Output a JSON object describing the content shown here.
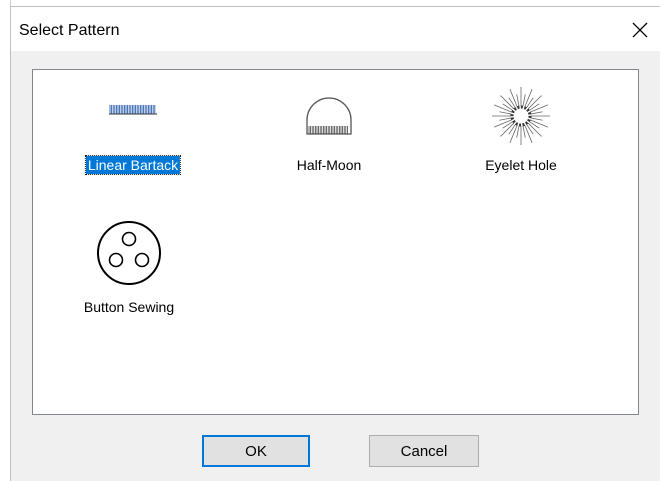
{
  "dialog": {
    "title": "Select Pattern",
    "close_icon": "close-icon"
  },
  "patterns": [
    {
      "label": "Linear Bartack",
      "icon": "linear-bartack-icon",
      "selected": true
    },
    {
      "label": "Half-Moon",
      "icon": "half-moon-icon",
      "selected": false
    },
    {
      "label": "Eyelet Hole",
      "icon": "eyelet-hole-icon",
      "selected": false
    },
    {
      "label": "Button Sewing",
      "icon": "button-sewing-icon",
      "selected": false
    }
  ],
  "buttons": {
    "ok_label": "OK",
    "cancel_label": "Cancel"
  },
  "colors": {
    "selection": "#0078d7",
    "stitch": "#2a5db0",
    "default_button_border": "#0078d7"
  }
}
